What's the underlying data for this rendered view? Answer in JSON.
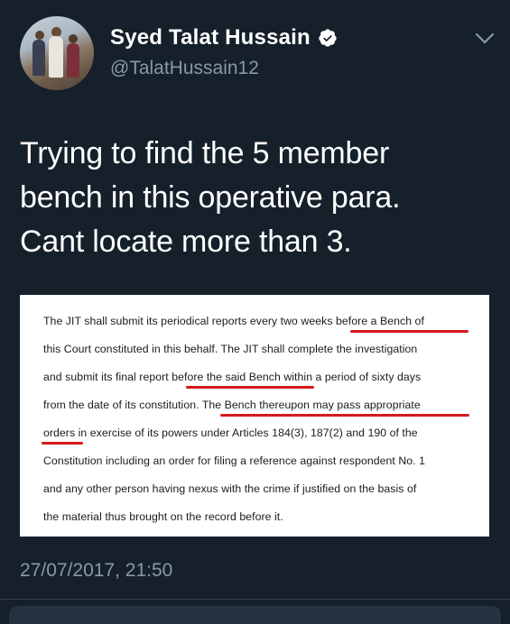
{
  "author": {
    "name": "Syed Talat Hussain",
    "handle": "@TalatHussain12",
    "verified_icon": "verified-badge-icon"
  },
  "menu_icon": "chevron-down-icon",
  "tweet": {
    "lines": [
      "Trying to find the 5 member",
      "bench in this operative para.",
      "Cant locate more than 3."
    ]
  },
  "document": {
    "lines": [
      "The JIT shall submit its periodical reports every two weeks before a Bench of",
      "this Court constituted in this behalf. The JIT shall complete the investigation",
      "and submit its final report before the said Bench within a period of sixty days",
      "from the date of its constitution. The Bench thereupon may pass appropriate",
      "orders in exercise of its powers under Articles 184(3), 187(2) and 190 of the",
      "Constitution including an order for filing a reference against respondent No. 1",
      "and any other person having nexus with the crime if justified on the basis of",
      "the material thus brought on the record before it."
    ],
    "highlight_color": "#d41a1a"
  },
  "timestamp": "27/07/2017, 21:50",
  "colors": {
    "background": "#15202b",
    "secondary_text": "#8899a6",
    "verified": "#ffffff"
  }
}
